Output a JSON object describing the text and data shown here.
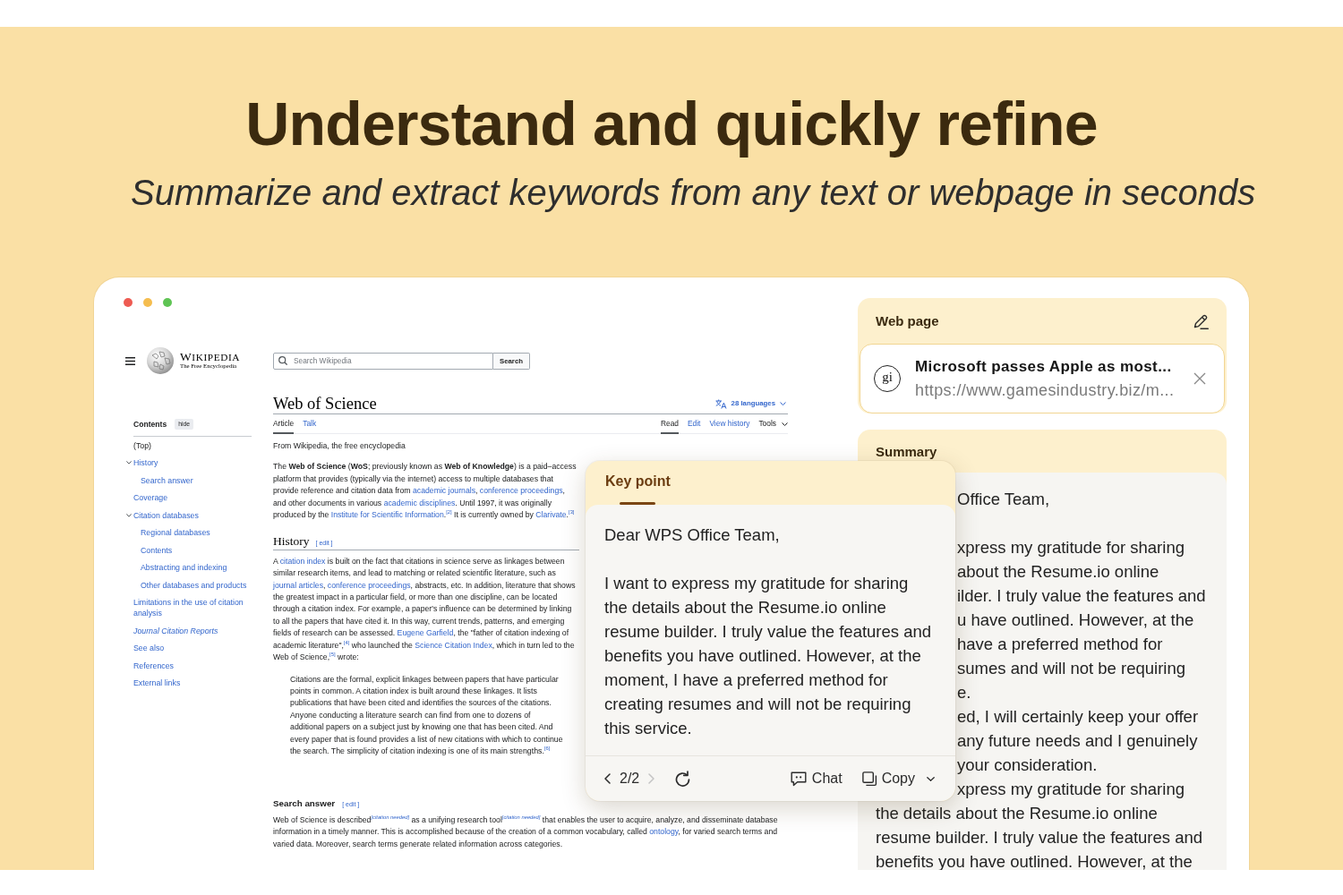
{
  "banner": {
    "title": "Understand and quickly refine",
    "subtitle": "Summarize and extract keywords from any text or webpage in seconds"
  },
  "wikipedia": {
    "wordmark": "WIKIPEDIA",
    "tagline": "The Free Encyclopedia",
    "search": {
      "placeholder": "Search Wikipedia",
      "button": "Search"
    },
    "contents": {
      "title": "Contents",
      "hide_button": "hide",
      "items": [
        {
          "label": "(Top)",
          "selected": true
        },
        {
          "label": "History",
          "selected": false,
          "expanded": true,
          "children": [
            {
              "label": "Search answer",
              "selected": false
            }
          ]
        },
        {
          "label": "Coverage",
          "selected": false
        },
        {
          "label": "Citation databases",
          "selected": false,
          "expanded": true,
          "children": [
            {
              "label": "Regional databases",
              "selected": false
            },
            {
              "label": "Contents",
              "selected": false
            },
            {
              "label": "Abstracting and indexing",
              "selected": false
            },
            {
              "label": "Other databases and products",
              "selected": false
            }
          ]
        },
        {
          "label": "Limitations in the use of citation analysis",
          "selected": false
        },
        {
          "label": "Journal Citation Reports",
          "selected": false,
          "italic": true
        },
        {
          "label": "See also",
          "selected": false
        },
        {
          "label": "References",
          "selected": false
        },
        {
          "label": "External links",
          "selected": false
        }
      ]
    },
    "article": {
      "title": "Web of Science",
      "languages": "28 languages",
      "namespace_tabs": [
        {
          "label": "Article",
          "selected": true,
          "kind": "link"
        },
        {
          "label": "Talk",
          "selected": false,
          "kind": "link"
        }
      ],
      "view_tabs": [
        {
          "label": "Read",
          "selected": true,
          "kind": "link"
        },
        {
          "label": "Edit",
          "selected": false,
          "kind": "link"
        },
        {
          "label": "View history",
          "selected": false,
          "kind": "link"
        },
        {
          "label": "Tools",
          "selected": false,
          "kind": "menu"
        }
      ],
      "from_line": "From Wikipedia, the free encyclopedia",
      "blocks": [
        {
          "kind": "paragraph",
          "segments": [
            {
              "kind": "text",
              "text": "The **Web of Science** (**WoS**; previously known as **Web of Knowledge**) is a paid–access platform that provides (typically via the internet) access to multiple databases that provide reference and citation data from "
            },
            {
              "kind": "link",
              "text": "academic journals"
            },
            {
              "kind": "text",
              "text": ", "
            },
            {
              "kind": "link",
              "text": "conference proceedings"
            },
            {
              "kind": "text",
              "text": ", and other documents in various "
            },
            {
              "kind": "link",
              "text": "academic disciplines"
            },
            {
              "kind": "text",
              "text": ". Until 1997, it was originally produced by the "
            },
            {
              "kind": "link",
              "text": "Institute for Scientific Information"
            },
            {
              "kind": "text",
              "text": "."
            },
            {
              "kind": "ref",
              "text": "[2]"
            },
            {
              "kind": "text",
              "text": " It is currently owned by "
            },
            {
              "kind": "link",
              "text": "Clarivate"
            },
            {
              "kind": "text",
              "text": "."
            },
            {
              "kind": "ref",
              "text": "[3]"
            }
          ]
        },
        {
          "kind": "section_heading",
          "text": "History",
          "edit_link": "[ edit ]"
        },
        {
          "kind": "paragraph",
          "segments": [
            {
              "kind": "text",
              "text": "A "
            },
            {
              "kind": "link",
              "text": "citation index"
            },
            {
              "kind": "text",
              "text": " is built on the fact that citations in science serve as linkages between similar research items, and lead to matching or related scientific literature, such as "
            },
            {
              "kind": "link",
              "text": "journal articles"
            },
            {
              "kind": "text",
              "text": ", "
            },
            {
              "kind": "link",
              "text": "conference proceedings"
            },
            {
              "kind": "text",
              "text": ", abstracts, etc. In addition, literature that shows the greatest impact in a particular field, or more than one discipline, can be located through a citation index. For example, a paper's influence can be determined by linking to all the papers that have cited it. In this way, current trends, patterns, and emerging fields of research can be assessed. "
            },
            {
              "kind": "link",
              "text": "Eugene Garfield"
            },
            {
              "kind": "text",
              "text": ", the \"father of citation indexing of academic literature\","
            },
            {
              "kind": "ref",
              "text": "[4]"
            },
            {
              "kind": "text",
              "text": " who launched the "
            },
            {
              "kind": "link",
              "text": "Science Citation Index"
            },
            {
              "kind": "text",
              "text": ", which in turn led to the Web of Science,"
            },
            {
              "kind": "ref",
              "text": "[5]"
            },
            {
              "kind": "text",
              "text": " wrote:"
            }
          ]
        },
        {
          "kind": "quote",
          "segments": [
            {
              "kind": "text",
              "text": "Citations are the formal, explicit linkages between papers that have particular points in common. A citation index is built around these linkages. It lists publications that have been cited and identifies the sources of the citations. Anyone conducting a literature search can find from one to dozens of additional papers on a subject just by knowing one that has been cited. And every paper that is found provides a list of new citations with which to continue the search. The simplicity of citation indexing is one of its main strengths."
            },
            {
              "kind": "ref",
              "text": "[6]"
            }
          ]
        },
        {
          "kind": "subsection_heading",
          "text": "Search answer",
          "edit_link": "[ edit ]"
        },
        {
          "kind": "paragraph",
          "segments": [
            {
              "kind": "text",
              "text": "Web of Science is described"
            },
            {
              "kind": "tag",
              "text": "[citation needed]"
            },
            {
              "kind": "text",
              "text": " as a unifying research tool"
            },
            {
              "kind": "tag",
              "text": "[citation needed]"
            },
            {
              "kind": "text",
              "text": " that enables the user to acquire, analyze, and disseminate database information in a timely manner. This is accomplished because of the creation of a common vocabulary, called "
            },
            {
              "kind": "link",
              "text": "ontology"
            },
            {
              "kind": "text",
              "text": ", for varied search terms and varied data. Moreover, search terms generate related information across categories."
            }
          ]
        }
      ]
    }
  },
  "web_page": {
    "title": "Web page",
    "source": {
      "logo": "gi",
      "title": "Microsoft passes Apple as most...",
      "url": "https://www.gamesindustry.biz/m..."
    }
  },
  "summary": {
    "title": "Summary",
    "partly_hidden_paragraphs": [
      [
        "Office Team,"
      ],
      [
        "xpress my gratitude for sharing",
        "about the Resume.io online",
        "ilder. I truly value the features and",
        "u have outlined. However, at the",
        "have a preferred method for",
        "sumes and will not be requiring",
        "e.",
        "ed, I will certainly keep your offer",
        "any future needs and I genuinely",
        "your consideration.",
        "xpress my gratitude for sharing"
      ]
    ],
    "lines": [
      "the details about the Resume.io online",
      "resume builder. I truly value the features and",
      "benefits you have outlined. However, at the"
    ]
  },
  "key_point": {
    "tabs": [
      {
        "label": "Key point",
        "selected": true
      }
    ],
    "greeting": "Dear WPS Office Team,",
    "body": "I want to express my gratitude for sharing the details about the Resume.io online resume builder. I truly value the features and benefits you have outlined. However, at the moment, I have a preferred method for creating resumes and will not be requiring this service.",
    "pager": {
      "label": "2/2",
      "previous_disabled": false,
      "next_disabled": true
    },
    "actions": [
      {
        "label": "Chat",
        "kind": "chat"
      },
      {
        "label": "Copy",
        "kind": "copy"
      }
    ]
  }
}
